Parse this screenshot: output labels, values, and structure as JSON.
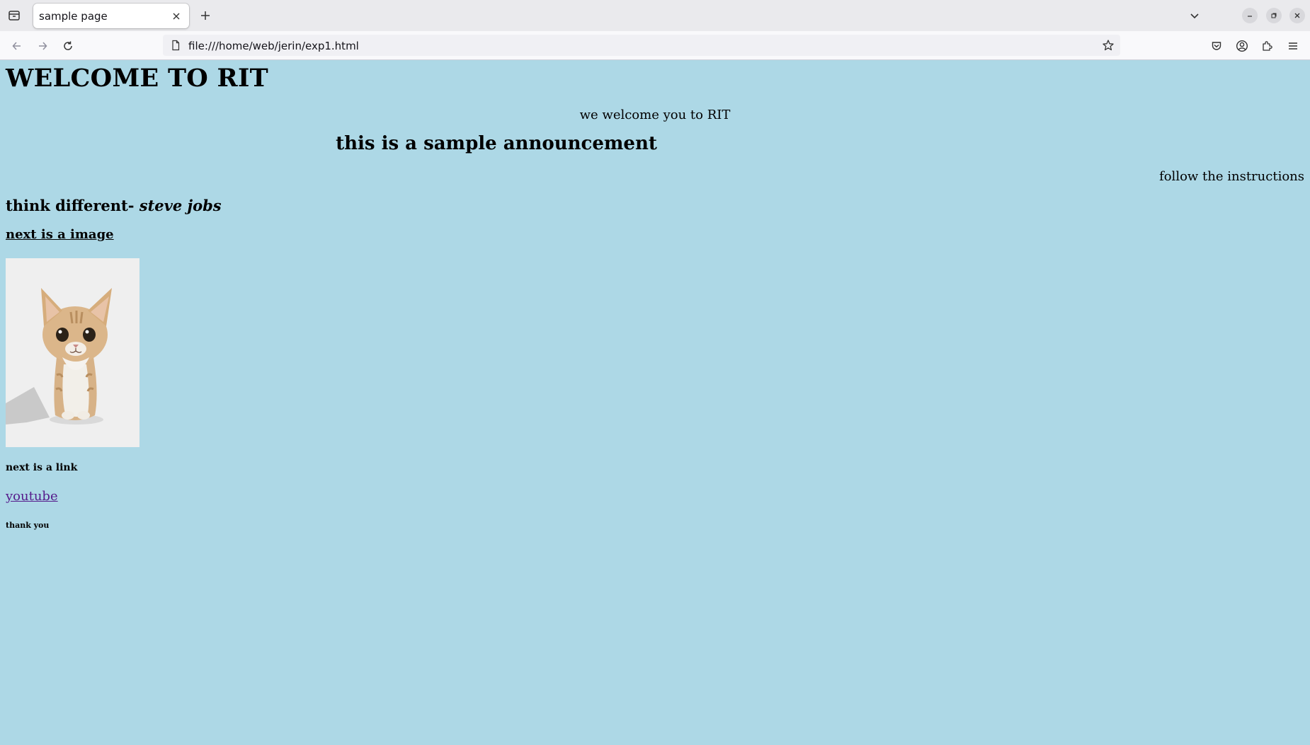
{
  "browser": {
    "tab": {
      "title": "sample page"
    },
    "url": "file:///home/web/jerin/exp1.html",
    "icons": {
      "tab_list": "tab-list-icon",
      "close_tab": "close-icon",
      "new_tab": "plus-icon",
      "list_all_tabs": "chevron-down-icon",
      "minimize": "minimize-icon",
      "restore": "restore-icon",
      "close_window": "close-icon",
      "back": "arrow-left-icon",
      "forward": "arrow-right-icon",
      "reload": "reload-icon",
      "page": "page-icon",
      "bookmark": "star-icon",
      "pocket": "pocket-icon",
      "account": "account-icon",
      "extensions": "puzzle-icon",
      "menu": "hamburger-menu-icon"
    }
  },
  "page": {
    "background": "#add8e6",
    "heading": "WELCOME TO RIT",
    "welcome_text": "we welcome you to RIT",
    "announcement": "this is a sample announcement",
    "instructions": "follow the instructions",
    "quote_text": "think different-",
    "quote_author": "steve jobs",
    "image_heading": "next is a image",
    "image_subject": "kitten-photo",
    "link_heading": "next is a link",
    "link_text": "youtube",
    "link_color": "#551a8b",
    "thanks": "thank you"
  }
}
